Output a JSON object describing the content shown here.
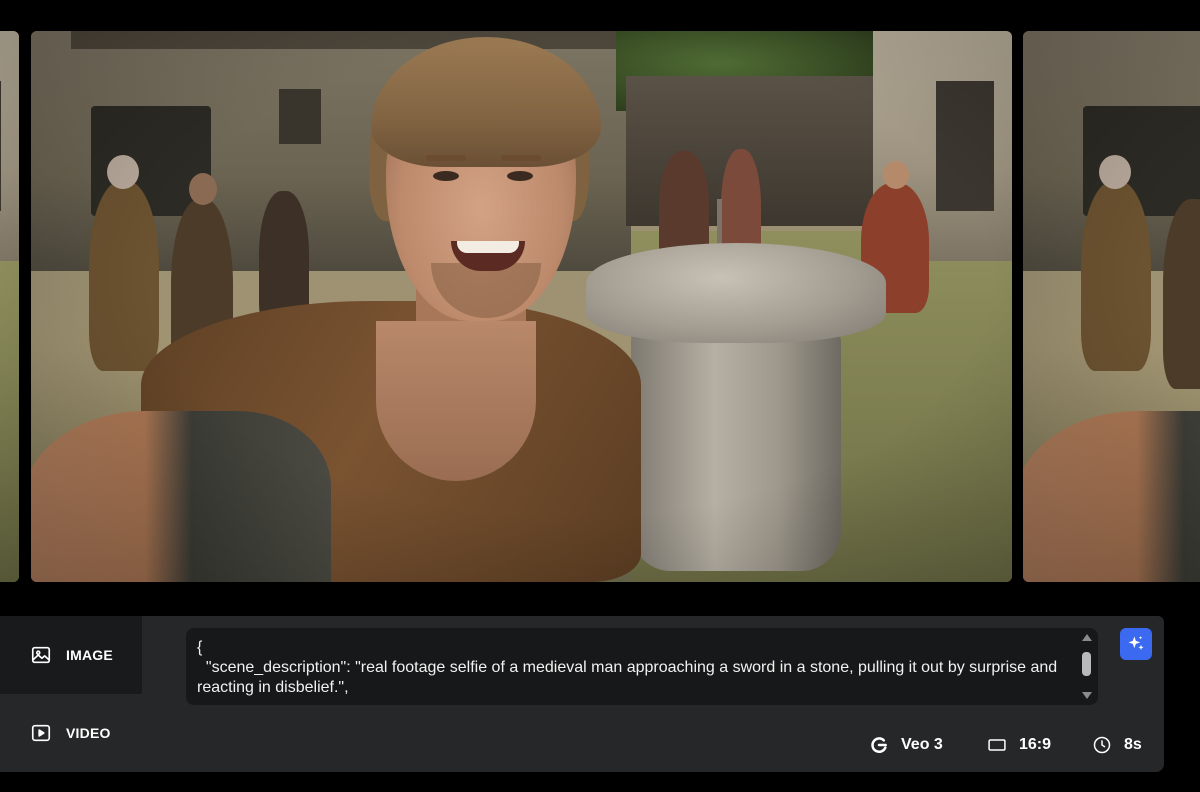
{
  "carousel": {
    "current_image": {
      "description": ""
    }
  },
  "mode_tabs": [
    {
      "label": "IMAGE",
      "icon": "image-icon",
      "selected": true
    },
    {
      "label": "VIDEO",
      "icon": "play-icon",
      "selected": false
    }
  ],
  "prompt": {
    "value": "{\n  \"scene_description\": \"real footage selfie of a medieval man approaching a sword in a stone, pulling it out by surprise and reacting in disbelief.\","
  },
  "enhance_button": {
    "icon": "sparkle-icon",
    "color": "#3b6af0"
  },
  "options": {
    "model": {
      "label": "Veo 3",
      "icon": "google-g-icon"
    },
    "aspect_ratio": {
      "label": "16:9",
      "icon": "aspect-ratio-icon"
    },
    "duration": {
      "label": "8s",
      "icon": "clock-icon"
    }
  },
  "colors": {
    "background": "#000000",
    "panel": "#262728",
    "selected_tab": "#191a1b",
    "prompt_box": "#171819",
    "accent": "#3b6af0"
  }
}
